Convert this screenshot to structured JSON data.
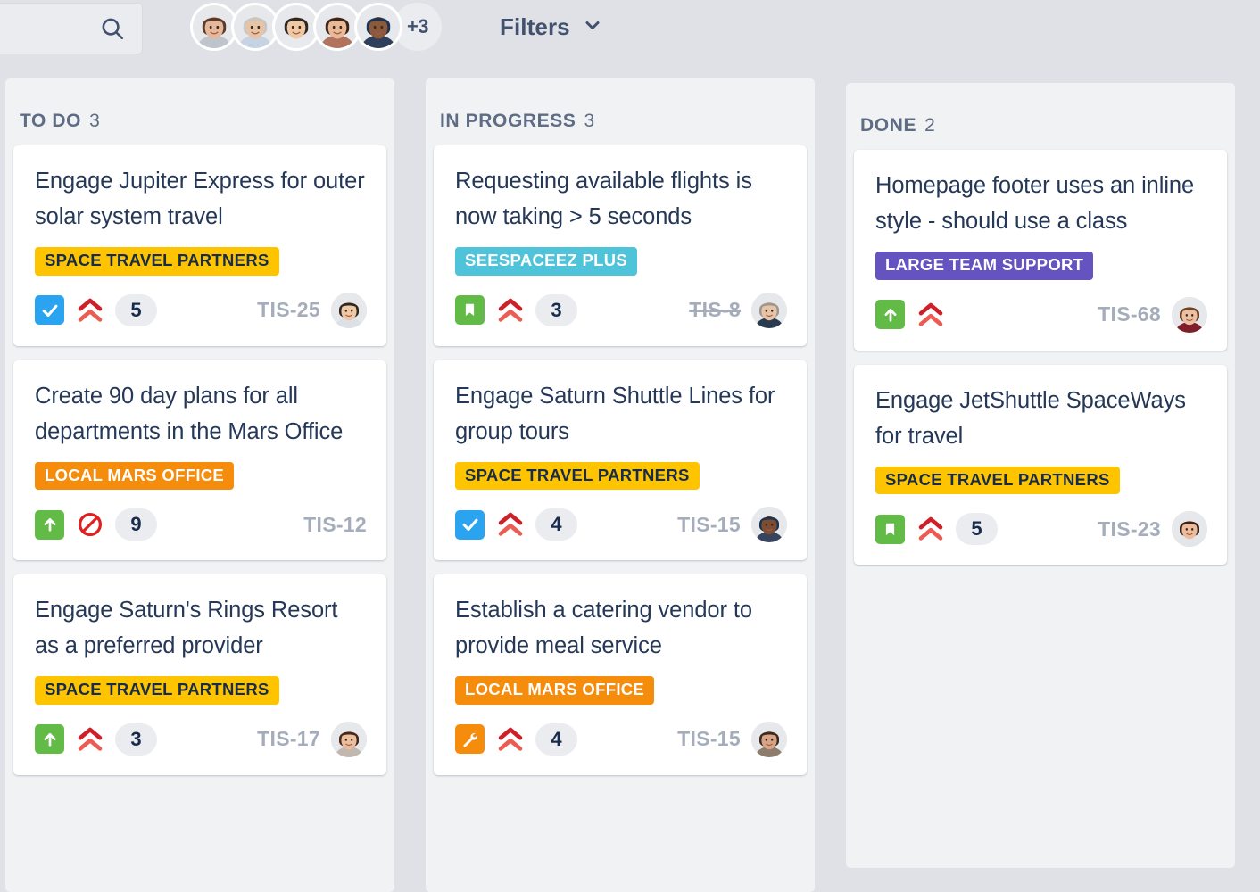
{
  "header": {
    "search": {
      "placeholder": "",
      "value": "",
      "icon": "search-icon"
    },
    "avatars": [
      {
        "name": "avatar-1",
        "skin": "#E7B79B",
        "hair": "#5A3A2A",
        "shirt": "#BFC4CC"
      },
      {
        "name": "avatar-2",
        "skin": "#E8C4A6",
        "hair": "#C9C6C2",
        "shirt": "#C6D3E3"
      },
      {
        "name": "avatar-3",
        "skin": "#F0C9A4",
        "hair": "#2E2722",
        "shirt": "#E8EAED"
      },
      {
        "name": "avatar-4",
        "skin": "#E9B894",
        "hair": "#3B2519",
        "shirt": "#B2735E"
      },
      {
        "name": "avatar-5",
        "skin": "#8A5A3B",
        "hair": "#1F3350",
        "shirt": "#2E3F5C"
      }
    ],
    "avatar_overflow": "+3",
    "filters_label": "Filters",
    "filters_chevron": "chevron-down-icon"
  },
  "colors": {
    "page_bg": "#DFE1E6",
    "column_bg": "#F1F2F4",
    "card_bg": "#FFFFFF",
    "title_text": "#253858",
    "muted_text": "#5E6C84",
    "key_text": "#A5ADBA",
    "tag_yellow": "#FFC400",
    "tag_orange": "#F58C0B",
    "tag_teal": "#4EC3DA",
    "tag_purple": "#6554C0",
    "priority_red": "#E02020",
    "type_task_blue": "#2AA3F0",
    "type_story_green": "#62BB46",
    "type_bug_orange": "#F58C0B"
  },
  "columns": [
    {
      "id": "todo",
      "title": "TO DO",
      "count": "3",
      "cards": [
        {
          "title": "Engage Jupiter Express for outer solar system travel",
          "tag": {
            "label": "SPACE TRAVEL PARTNERS",
            "style": "yellow"
          },
          "type_icon": "task-checkbox-icon",
          "type_style": "task",
          "priority_icon": "priority-highest-icon",
          "points": "5",
          "key": "TIS-25",
          "key_resolved": false,
          "assignee": {
            "name": "avatar-male-young",
            "skin": "#F0C9A4",
            "hair": "#2E2722",
            "shirt": "#DDE1E6"
          }
        },
        {
          "title": "Create 90 day plans for all departments in the Mars Office",
          "tag": {
            "label": "LOCAL MARS OFFICE",
            "style": "orange"
          },
          "type_icon": "story-arrow-up-icon",
          "type_style": "story",
          "priority_icon": "priority-blocker-icon",
          "points": "9",
          "key": "TIS-12",
          "key_resolved": false,
          "assignee": null
        },
        {
          "title": "Engage Saturn's Rings Resort as a preferred provider",
          "tag": {
            "label": "SPACE TRAVEL PARTNERS",
            "style": "yellow"
          },
          "type_icon": "story-arrow-up-icon",
          "type_style": "story",
          "priority_icon": "priority-highest-icon",
          "points": "3",
          "key": "TIS-17",
          "key_resolved": false,
          "assignee": {
            "name": "avatar-female-brunette",
            "skin": "#EDBE9C",
            "hair": "#44281B",
            "shirt": "#C2B7AE"
          }
        }
      ]
    },
    {
      "id": "inprogress",
      "title": "IN PROGRESS",
      "count": "3",
      "cards": [
        {
          "title": "Requesting available flights is now taking > 5 seconds",
          "tag": {
            "label": "SEESPACEEZ PLUS",
            "style": "teal"
          },
          "type_icon": "story-bookmark-icon",
          "type_style": "bookmark",
          "priority_icon": "priority-highest-icon",
          "points": "3",
          "key": "TIS-8",
          "key_resolved": true,
          "assignee": {
            "name": "avatar-male-grey",
            "skin": "#E8C4A6",
            "hair": "#9B9894",
            "shirt": "#2A3B4F"
          }
        },
        {
          "title": "Engage Saturn Shuttle Lines for group tours",
          "tag": {
            "label": "SPACE TRAVEL PARTNERS",
            "style": "yellow"
          },
          "type_icon": "task-checkbox-icon",
          "type_style": "task",
          "priority_icon": "priority-highest-icon",
          "points": "4",
          "key": "TIS-15",
          "key_resolved": false,
          "assignee": {
            "name": "avatar-male-hat",
            "skin": "#7D4E32",
            "hair": "#1F3350",
            "shirt": "#36445E"
          }
        },
        {
          "title": "Establish a catering vendor to provide meal service",
          "tag": {
            "label": "LOCAL MARS OFFICE",
            "style": "orange"
          },
          "type_icon": "bug-wrench-icon",
          "type_style": "bug",
          "priority_icon": "priority-highest-icon",
          "points": "4",
          "key": "TIS-15",
          "key_resolved": false,
          "assignee": {
            "name": "avatar-female-outdoors",
            "skin": "#D7A585",
            "hair": "#3A2A20",
            "shirt": "#8E7C6C"
          }
        }
      ]
    },
    {
      "id": "done",
      "title": "DONE",
      "count": "2",
      "cards": [
        {
          "title": "Homepage footer uses an inline style - should use a class",
          "tag": {
            "label": "LARGE TEAM SUPPORT",
            "style": "purple"
          },
          "type_icon": "story-arrow-up-icon",
          "type_style": "story",
          "priority_icon": "priority-highest-icon",
          "points": null,
          "key": "TIS-68",
          "key_resolved": false,
          "assignee": {
            "name": "avatar-female-red",
            "skin": "#EBC1A2",
            "hair": "#6B4328",
            "shirt": "#7E1F2A"
          }
        },
        {
          "title": "Engage JetShuttle SpaceWays for travel",
          "tag": {
            "label": "SPACE TRAVEL PARTNERS",
            "style": "yellow"
          },
          "type_icon": "story-bookmark-icon",
          "type_style": "bookmark",
          "priority_icon": "priority-highest-icon",
          "points": "5",
          "key": "TIS-23",
          "key_resolved": false,
          "assignee": {
            "name": "avatar-female-dark-hair",
            "skin": "#EDBD9B",
            "hair": "#3A2218",
            "shirt": "#E2E5E9"
          }
        }
      ]
    }
  ]
}
